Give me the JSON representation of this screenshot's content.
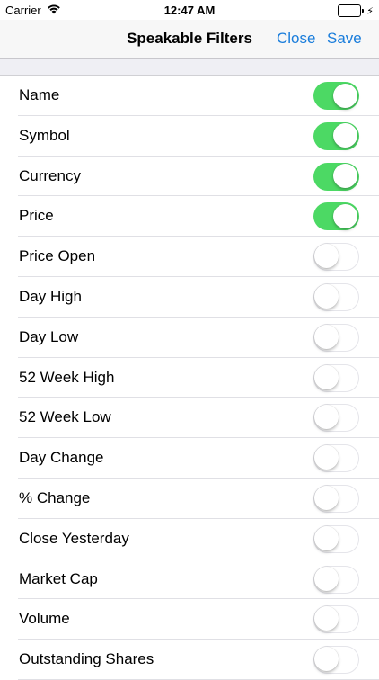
{
  "status_bar": {
    "carrier": "Carrier",
    "time": "12:47 AM",
    "battery_color": "#4cd964"
  },
  "nav": {
    "title": "Speakable Filters",
    "close_label": "Close",
    "save_label": "Save",
    "accent_color": "#1a7ddb"
  },
  "filters": [
    {
      "label": "Name",
      "enabled": true
    },
    {
      "label": "Symbol",
      "enabled": true
    },
    {
      "label": "Currency",
      "enabled": true
    },
    {
      "label": "Price",
      "enabled": true
    },
    {
      "label": "Price Open",
      "enabled": false
    },
    {
      "label": "Day High",
      "enabled": false
    },
    {
      "label": "Day Low",
      "enabled": false
    },
    {
      "label": "52 Week High",
      "enabled": false
    },
    {
      "label": "52 Week Low",
      "enabled": false
    },
    {
      "label": "Day Change",
      "enabled": false
    },
    {
      "label": "% Change",
      "enabled": false
    },
    {
      "label": "Close Yesterday",
      "enabled": false
    },
    {
      "label": "Market Cap",
      "enabled": false
    },
    {
      "label": "Volume",
      "enabled": false
    },
    {
      "label": "Outstanding Shares",
      "enabled": false
    }
  ],
  "toggle_on_color": "#4cd964"
}
